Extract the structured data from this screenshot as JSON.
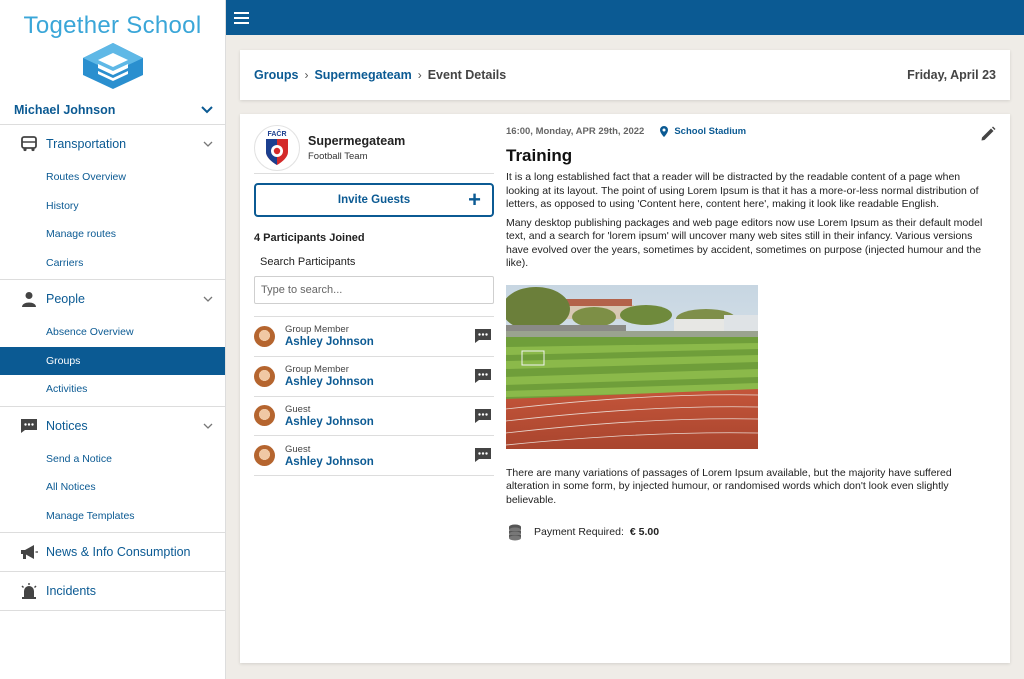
{
  "brand": {
    "name": "Together School"
  },
  "user": {
    "name": "Michael Johnson"
  },
  "nav": {
    "transportation": {
      "label": "Transportation",
      "items": [
        "Routes Overview",
        "History",
        "Manage routes",
        "Carriers"
      ]
    },
    "people": {
      "label": "People",
      "items": [
        "Absence Overview",
        "Groups",
        "Activities"
      ],
      "active": "Groups"
    },
    "notices": {
      "label": "Notices",
      "items": [
        "Send a Notice",
        "All Notices",
        "Manage Templates"
      ]
    },
    "news": {
      "label": "News & Info Consumption"
    },
    "incidents": {
      "label": "Incidents"
    }
  },
  "breadcrumb": {
    "items": [
      "Groups",
      "Supermegateam"
    ],
    "current": "Event Details"
  },
  "header": {
    "date": "Friday, April 23"
  },
  "team": {
    "name": "Supermegateam",
    "type": "Football Team",
    "logo_text": "FAČR"
  },
  "invite": {
    "label": "Invite Guests"
  },
  "participants": {
    "count_label": "4 Participants Joined",
    "search_label": "Search Participants",
    "search_placeholder": "Type to search...",
    "list": [
      {
        "role": "Group Member",
        "name": "Ashley Johnson"
      },
      {
        "role": "Group Member",
        "name": "Ashley Johnson"
      },
      {
        "role": "Guest",
        "name": "Ashley Johnson"
      },
      {
        "role": "Guest",
        "name": "Ashley Johnson"
      }
    ]
  },
  "event": {
    "datetime": "16:00, Monday, APR 29th, 2022",
    "location": "School Stadium",
    "title": "Training",
    "paragraphs": [
      "It is a long established fact that a reader will be distracted by the readable content of a page when looking at its layout. The point of using Lorem Ipsum is that it has a more-or-less normal distribution of letters, as opposed to using 'Content here, content here', making it look like readable English.",
      "Many desktop publishing packages and web page editors now use Lorem Ipsum as their default model text, and a search for 'lorem ipsum' will uncover many web sites still in their infancy. Various versions have evolved over the years, sometimes by accident, sometimes on purpose (injected humour and the like).",
      "There are many variations of passages of Lorem Ipsum available, but the majority have suffered alteration in some form, by injected humour, or randomised words which don't look even slightly believable."
    ],
    "payment_label": "Payment Required:",
    "payment_amount": "€ 5.00"
  },
  "colors": {
    "primary": "#0b5a93",
    "logo": "#3aa6d8",
    "background": "#efece7"
  },
  "icons": {
    "menu": "hamburger-icon",
    "expand": "chevron-down-icon",
    "transportation": "bus-icon",
    "people": "person-icon",
    "notices": "chat-bubble-icon",
    "news": "megaphone-icon",
    "incidents": "siren-icon",
    "location": "map-pin-icon",
    "edit": "pencil-icon",
    "message": "chat-bubble-icon",
    "payment": "coins-icon"
  }
}
